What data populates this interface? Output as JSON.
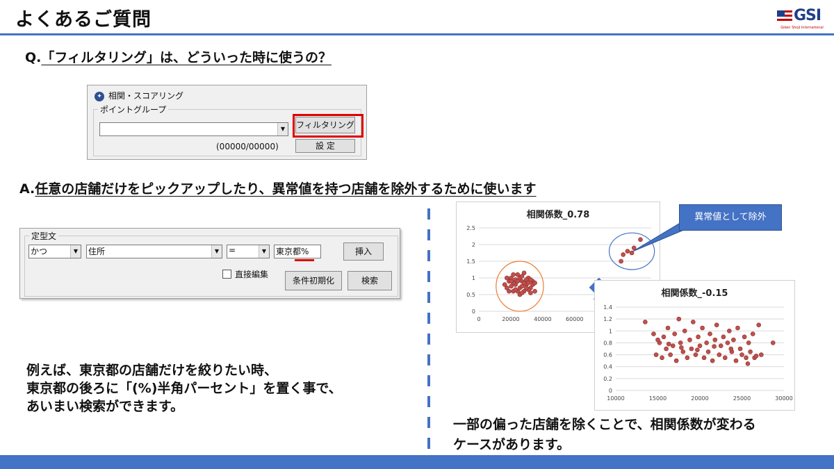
{
  "header": {
    "title": "よくあるご質問",
    "logo_text": "GSI",
    "logo_sub": "Giken Shoji International"
  },
  "question": {
    "prefix": "Q.",
    "text": "「フィルタリング」は、どういった時に使うの？"
  },
  "dialog1": {
    "title": "相関・スコアリング",
    "group_label": "ポイントグループ",
    "combo_value": "",
    "filter_button": "フィルタリング",
    "count": "(00000/00000)",
    "settings_button": "設 定"
  },
  "answer": {
    "prefix": "A.",
    "text": "任意の店舗だけをピックアップしたり、異常値を持つ店舗を除外するために使います"
  },
  "dialog2": {
    "group_label": "定型文",
    "logic_value": "かつ",
    "field_value": "住所",
    "operator_value": "=",
    "input_value": "東京都%",
    "insert_button": "挿入",
    "direct_edit_label": "直接編集",
    "reset_button": "条件初期化",
    "search_button": "検索"
  },
  "example": {
    "line1": "例えば、東京都の店舗だけを絞りたい時、",
    "line2": "東京都の後ろに「(%)半角パーセント」を置く事で、",
    "line3": "あいまい検索ができます。"
  },
  "callout": "異常値として除外",
  "conclusion": {
    "line1": "一部の偏った店舗を除くことで、相関係数が変わる",
    "line2": "ケースがあります。"
  },
  "colors": {
    "accent": "#4472c4",
    "highlight": "#e00000",
    "point": "#c0504d",
    "ellipse_outlier": "#4472c4",
    "ellipse_cluster": "#ed7d31"
  },
  "chart_data": [
    {
      "type": "scatter",
      "title": "相関係数_0.78",
      "xlim": [
        0,
        80000
      ],
      "ylim": [
        0,
        2.5
      ],
      "xticks": [
        "0",
        "20000",
        "40000",
        "60000"
      ],
      "yticks": [
        "0",
        "0.5",
        "1",
        "1.5",
        "2",
        "2.5"
      ],
      "grid": true,
      "points": [
        [
          12000,
          0.8
        ],
        [
          13000,
          0.7
        ],
        [
          14000,
          0.9
        ],
        [
          15000,
          1.0
        ],
        [
          16000,
          0.6
        ],
        [
          17000,
          0.8
        ],
        [
          18000,
          1.1
        ],
        [
          19000,
          0.7
        ],
        [
          20000,
          0.9
        ],
        [
          21000,
          0.6
        ],
        [
          22000,
          0.8
        ],
        [
          23000,
          1.0
        ],
        [
          24000,
          0.7
        ],
        [
          25000,
          0.9
        ],
        [
          26000,
          0.6
        ],
        [
          14000,
          0.6
        ],
        [
          15000,
          0.75
        ],
        [
          17000,
          0.95
        ],
        [
          19000,
          1.0
        ],
        [
          21000,
          0.85
        ],
        [
          23000,
          0.65
        ],
        [
          25000,
          0.8
        ],
        [
          13000,
          1.0
        ],
        [
          16000,
          0.85
        ],
        [
          18000,
          0.6
        ],
        [
          20000,
          0.75
        ],
        [
          22000,
          0.95
        ],
        [
          24000,
          0.55
        ],
        [
          26000,
          0.85
        ],
        [
          18000,
          0.9
        ],
        [
          20000,
          1.05
        ],
        [
          16000,
          1.1
        ],
        [
          22000,
          0.7
        ],
        [
          19000,
          0.5
        ],
        [
          24000,
          0.95
        ],
        [
          21000,
          1.15
        ],
        [
          17000,
          0.65
        ],
        [
          15000,
          0.9
        ],
        [
          23000,
          0.85
        ],
        [
          20000,
          0.55
        ],
        [
          66000,
          1.5
        ],
        [
          67000,
          1.7
        ],
        [
          69000,
          1.8
        ],
        [
          71000,
          1.75
        ],
        [
          72000,
          1.9
        ],
        [
          75000,
          2.15
        ]
      ]
    },
    {
      "type": "scatter",
      "title": "相関係数_-0.15",
      "xlim": [
        10000,
        30000
      ],
      "ylim": [
        0,
        1.4
      ],
      "xticks": [
        "10000",
        "15000",
        "20000",
        "25000",
        "30000"
      ],
      "yticks": [
        "0",
        "0.2",
        "0.4",
        "0.6",
        "0.8",
        "1",
        "1.2",
        "1.4"
      ],
      "grid": true,
      "points": [
        [
          13500,
          1.15
        ],
        [
          14500,
          0.95
        ],
        [
          14800,
          0.6
        ],
        [
          15200,
          0.8
        ],
        [
          15500,
          0.55
        ],
        [
          15700,
          0.9
        ],
        [
          16000,
          0.7
        ],
        [
          16200,
          1.05
        ],
        [
          16500,
          0.6
        ],
        [
          16800,
          0.75
        ],
        [
          17000,
          0.95
        ],
        [
          17200,
          0.5
        ],
        [
          17500,
          1.2
        ],
        [
          17700,
          0.8
        ],
        [
          18000,
          0.65
        ],
        [
          18200,
          1.0
        ],
        [
          18500,
          0.55
        ],
        [
          18800,
          0.85
        ],
        [
          19000,
          0.7
        ],
        [
          19200,
          1.15
        ],
        [
          19500,
          0.6
        ],
        [
          19800,
          0.9
        ],
        [
          20000,
          0.75
        ],
        [
          20300,
          1.05
        ],
        [
          20500,
          0.55
        ],
        [
          20800,
          0.8
        ],
        [
          21000,
          0.65
        ],
        [
          21200,
          0.95
        ],
        [
          21500,
          0.5
        ],
        [
          21800,
          0.85
        ],
        [
          22000,
          1.1
        ],
        [
          22300,
          0.6
        ],
        [
          22500,
          0.75
        ],
        [
          22800,
          0.9
        ],
        [
          23000,
          0.55
        ],
        [
          23300,
          0.8
        ],
        [
          23500,
          1.0
        ],
        [
          23800,
          0.65
        ],
        [
          24000,
          0.85
        ],
        [
          24300,
          0.5
        ],
        [
          24500,
          1.05
        ],
        [
          24800,
          0.7
        ],
        [
          25000,
          0.6
        ],
        [
          25300,
          0.9
        ],
        [
          25500,
          0.55
        ],
        [
          25800,
          0.8
        ],
        [
          26000,
          0.65
        ],
        [
          26300,
          0.95
        ],
        [
          26500,
          0.55
        ],
        [
          27000,
          1.1
        ],
        [
          27300,
          0.6
        ],
        [
          28700,
          0.8
        ],
        [
          15000,
          0.85
        ],
        [
          16300,
          0.78
        ],
        [
          17800,
          0.72
        ],
        [
          19700,
          0.68
        ],
        [
          21700,
          0.74
        ],
        [
          23700,
          0.7
        ],
        [
          25700,
          0.45
        ],
        [
          26700,
          0.58
        ]
      ]
    }
  ]
}
